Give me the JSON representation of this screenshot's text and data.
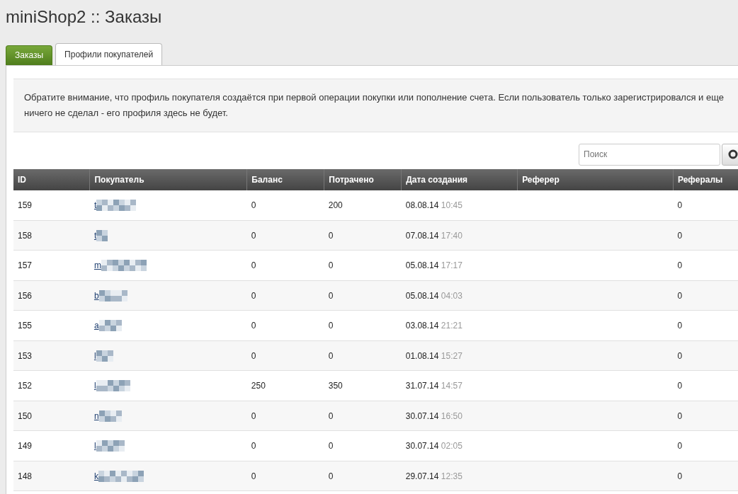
{
  "page_title": "miniShop2 :: Заказы",
  "tabs": [
    {
      "label": "Заказы",
      "selected": false
    },
    {
      "label": "Профили покупателей",
      "selected": true
    }
  ],
  "notice": "Обратите внимание, что профиль покупателя создаётся при первой операции покупки или пополнение счета. Если пользователь только зарегистрировался и еще ничего не сделал - его профиля здесь не будет.",
  "search": {
    "placeholder": "Поиск"
  },
  "table": {
    "columns": [
      "ID",
      "Покупатель",
      "Баланс",
      "Потрачено",
      "Дата создания",
      "Реферер",
      "Рефералы"
    ],
    "rows": [
      {
        "id": "159",
        "buyer": "t",
        "balance": "0",
        "spent": "200",
        "date": "08.08.14",
        "time": "10:45",
        "referrals": "0"
      },
      {
        "id": "158",
        "buyer": "t",
        "balance": "0",
        "spent": "0",
        "date": "07.08.14",
        "time": "17:40",
        "referrals": "0"
      },
      {
        "id": "157",
        "buyer": "m",
        "balance": "0",
        "spent": "0",
        "date": "05.08.14",
        "time": "17:17",
        "referrals": "0"
      },
      {
        "id": "156",
        "buyer": "b",
        "balance": "0",
        "spent": "0",
        "date": "05.08.14",
        "time": "04:03",
        "referrals": "0"
      },
      {
        "id": "155",
        "buyer": "a",
        "balance": "0",
        "spent": "0",
        "date": "03.08.14",
        "time": "21:21",
        "referrals": "0"
      },
      {
        "id": "153",
        "buyer": "l",
        "balance": "0",
        "spent": "0",
        "date": "01.08.14",
        "time": "15:27",
        "referrals": "0"
      },
      {
        "id": "152",
        "buyer": "l",
        "balance": "250",
        "spent": "350",
        "date": "31.07.14",
        "time": "14:57",
        "referrals": "0"
      },
      {
        "id": "150",
        "buyer": "n",
        "balance": "0",
        "spent": "0",
        "date": "30.07.14",
        "time": "16:50",
        "referrals": "0"
      },
      {
        "id": "149",
        "buyer": "l",
        "balance": "0",
        "spent": "0",
        "date": "30.07.14",
        "time": "02:05",
        "referrals": "0"
      },
      {
        "id": "148",
        "buyer": "k",
        "balance": "0",
        "spent": "0",
        "date": "29.07.14",
        "time": "12:35",
        "referrals": "0"
      }
    ]
  }
}
